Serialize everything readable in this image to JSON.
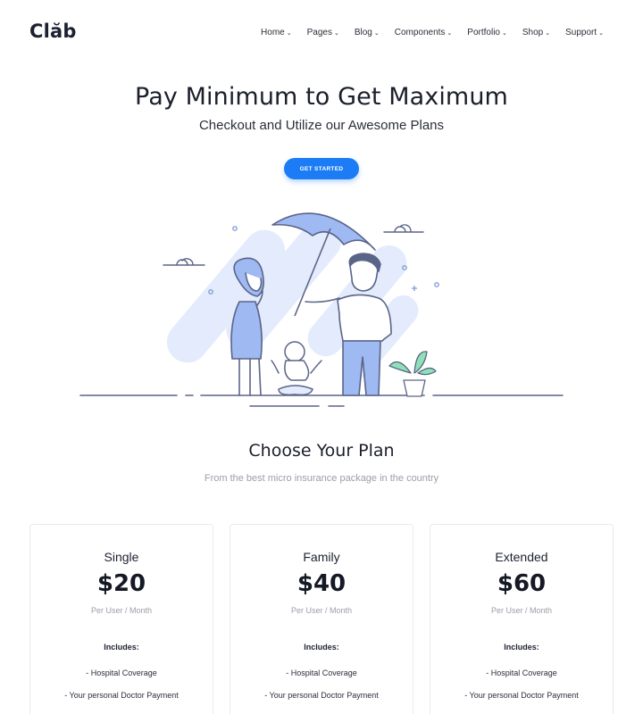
{
  "brand": {
    "logo": "Clăb"
  },
  "nav": {
    "items": [
      {
        "label": "Home"
      },
      {
        "label": "Pages"
      },
      {
        "label": "Blog"
      },
      {
        "label": "Components"
      },
      {
        "label": "Portfolio"
      },
      {
        "label": "Shop"
      },
      {
        "label": "Support"
      }
    ],
    "dropdown_icon": "chevron-down-icon"
  },
  "hero": {
    "title": "Pay Minimum to Get Maximum",
    "subtitle": "Checkout and Utilize our Awesome Plans",
    "cta_label": "GET STARTED",
    "illustration": "family-umbrella-illustration"
  },
  "plans_section": {
    "title": "Choose Your Plan",
    "subtitle": "From the best micro insurance package in the country"
  },
  "plans": [
    {
      "name": "Single",
      "price": "$20",
      "period": "Per User / Month",
      "includes_label": "Includes:",
      "features": [
        "- Hospital Coverage",
        "- Your personal Doctor Payment"
      ]
    },
    {
      "name": "Family",
      "price": "$40",
      "period": "Per User / Month",
      "includes_label": "Includes:",
      "features": [
        "- Hospital Coverage",
        "- Your personal Doctor Payment"
      ]
    },
    {
      "name": "Extended",
      "price": "$60",
      "period": "Per User / Month",
      "includes_label": "Includes:",
      "features": [
        "- Hospital Coverage",
        "- Your personal Doctor Payment"
      ]
    }
  ],
  "colors": {
    "accent": "#1b7cf6",
    "illustration_fill": "#9fb9f3",
    "illustration_light": "#e3ebfd",
    "illustration_stroke": "#5a6487",
    "plant": "#8fe0b8"
  }
}
